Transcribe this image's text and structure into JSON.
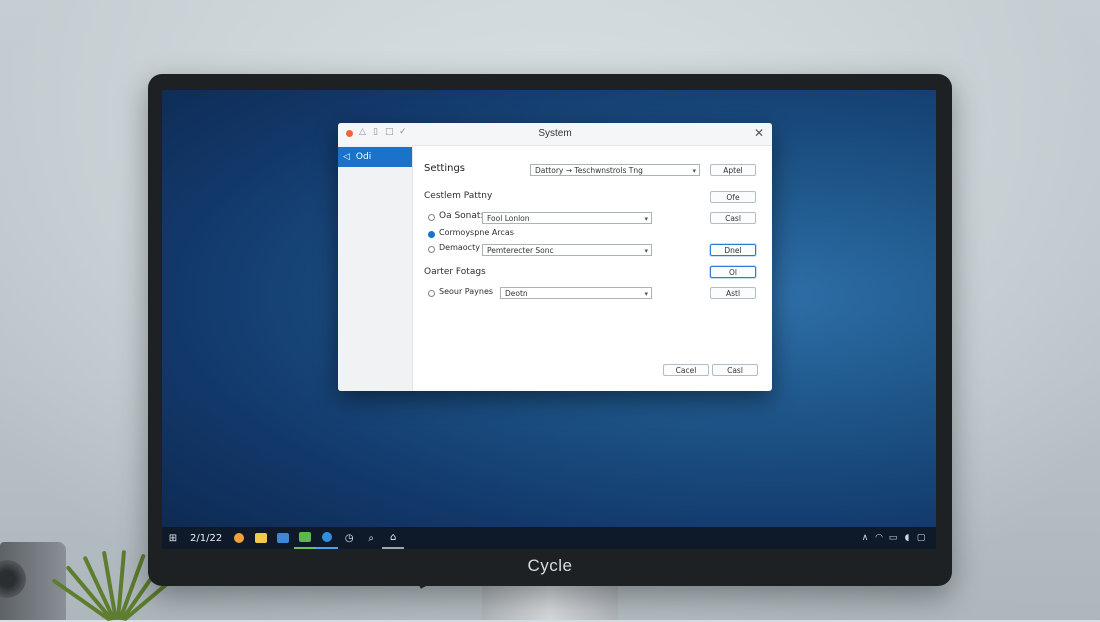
{
  "brand": "Cycle",
  "dialog": {
    "title": "System",
    "close_glyph": "✕",
    "sidebar_items": [
      {
        "label": "Odi",
        "icon": "back-arrow-icon"
      }
    ],
    "settings_label": "Settings",
    "settings_dropdown": "Dattory → Teschwnstrols Tng",
    "apply_button": "Aptel",
    "section1_title": "Cestlem Pattny",
    "option1_label": "Oa Sonat:",
    "option1_dropdown": "Fool Lonlon",
    "option2_label": "Cormoyspne Arcas",
    "option3_label": "Demaocty",
    "option3_dropdown": "Pemterecter Sonc",
    "section2_title": "Oarter Fotags",
    "option4_label": "Seour Paynes",
    "option4_dropdown": "Deotn",
    "right_buttons": [
      "Ofe",
      "Casl",
      "Dnel",
      "Ol",
      "Astl"
    ],
    "footer_buttons": [
      "Cacel",
      "Casl"
    ],
    "option2_checked": true
  },
  "taskbar": {
    "time": "2/1/22",
    "tray_icons": [
      "chevron-up-icon",
      "wifi-icon",
      "battery-icon",
      "speaker-icon",
      "notification-icon"
    ]
  },
  "colors": {
    "accent": "#1a73c8",
    "desktop": "#1d5487",
    "taskbar": "#0e1a2a"
  }
}
